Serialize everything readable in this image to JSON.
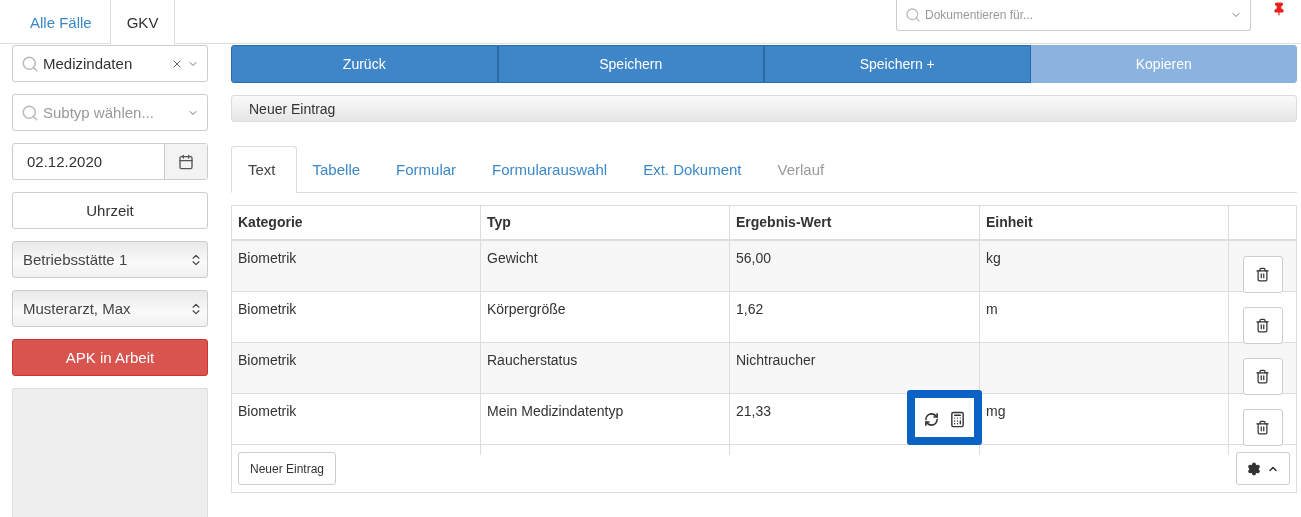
{
  "case_tabs": [
    {
      "label": "Alle Fälle",
      "selected": false
    },
    {
      "label": "GKV",
      "selected": true
    }
  ],
  "document_search": {
    "placeholder": "Dokumentieren für..."
  },
  "sidebar": {
    "type_select": {
      "value": "Medizindaten"
    },
    "subtype_select": {
      "placeholder": "Subtyp wählen..."
    },
    "date": {
      "value": "02.12.2020"
    },
    "time_button": "Uhrzeit",
    "site_select": "Betriebsstätte 1",
    "doctor_select": "Musterarzt, Max",
    "status_button": "APK in Arbeit"
  },
  "actions": [
    {
      "label": "Zurück",
      "disabled": false
    },
    {
      "label": "Speichern",
      "disabled": false
    },
    {
      "label": "Speichern +",
      "disabled": false
    },
    {
      "label": "Kopieren",
      "disabled": true
    }
  ],
  "entry_bar": "Neuer Eintrag",
  "tabs": [
    {
      "label": "Text",
      "selected": true,
      "disabled": false
    },
    {
      "label": "Tabelle",
      "selected": false,
      "disabled": false
    },
    {
      "label": "Formular",
      "selected": false,
      "disabled": false
    },
    {
      "label": "Formularauswahl",
      "selected": false,
      "disabled": false
    },
    {
      "label": "Ext. Dokument",
      "selected": false,
      "disabled": false
    },
    {
      "label": "Verlauf",
      "selected": false,
      "disabled": true
    }
  ],
  "table": {
    "columns": [
      "Kategorie",
      "Typ",
      "Ergebnis-Wert",
      "Einheit"
    ],
    "rows": [
      {
        "cells": [
          "Biometrik",
          "Gewicht",
          "56,00",
          "kg"
        ]
      },
      {
        "cells": [
          "Biometrik",
          "Körpergröße",
          "1,62",
          "m"
        ]
      },
      {
        "cells": [
          "Biometrik",
          "Raucherstatus",
          "Nichtraucher",
          ""
        ]
      },
      {
        "cells": [
          "Biometrik",
          "Mein Medizindatentyp",
          "21,33",
          "mg"
        ],
        "tools_highlighted": true
      }
    ],
    "new_entry_button": "Neuer Eintrag"
  }
}
